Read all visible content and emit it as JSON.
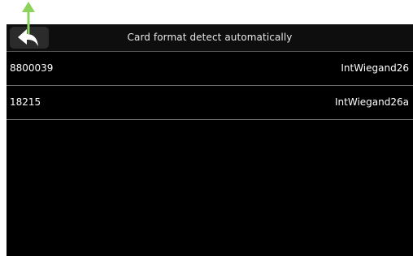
{
  "header": {
    "title": "Card format detect automatically",
    "back_icon": "back-arrow-icon"
  },
  "cards": [
    {
      "number": "8800039",
      "format": "IntWiegand26"
    },
    {
      "number": "18215",
      "format": "IntWiegand26a"
    }
  ],
  "colors": {
    "screen_bg": "#000000",
    "header_bg": "#0e0e0e",
    "pointer_arrow": "#8dd35b"
  }
}
